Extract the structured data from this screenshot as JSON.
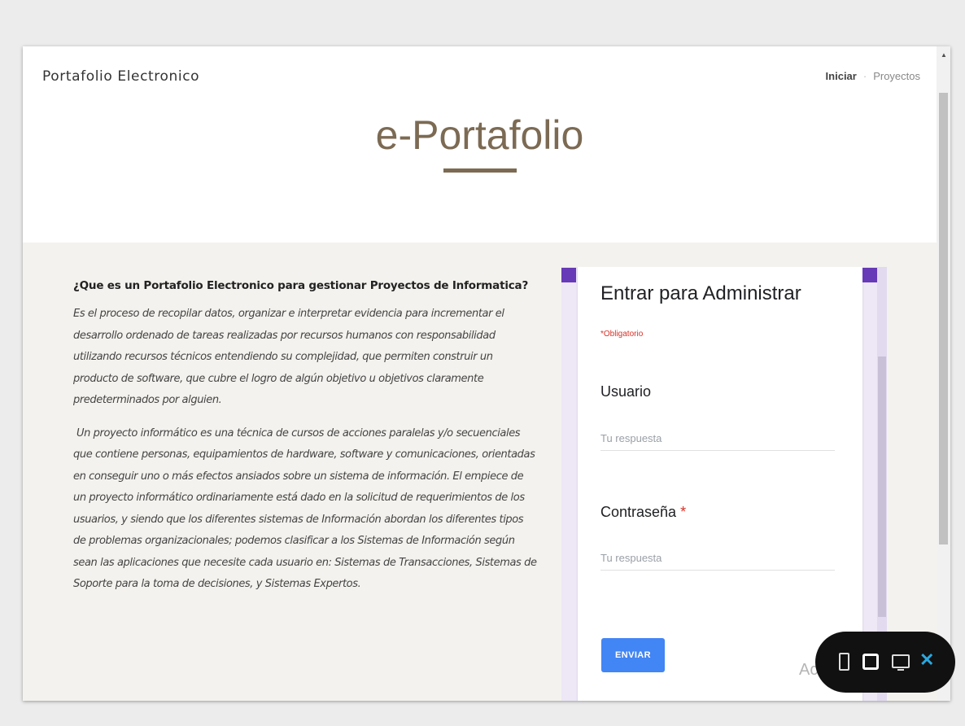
{
  "header": {
    "brand": "Portafolio Electronico",
    "nav": [
      "Iniciar",
      "Proyectos"
    ],
    "title": "e-Portafolio"
  },
  "content": {
    "question": "¿Que es un Portafolio Electronico para gestionar Proyectos de Informatica?",
    "paragraph1": "Es el proceso de recopilar datos, organizar e interpretar evidencia para incrementar el desarrollo ordenado de tareas realizadas por recursos humanos con responsabilidad utilizando recursos técnicos entendiendo su complejidad, que permiten construir un producto de software, que cubre el logro de algún objetivo u objetivos claramente predeterminados por alguien.",
    "paragraph2": "Un proyecto informático es una técnica de cursos de acciones paralelas y/o secuenciales que contiene personas, equipamientos de hardware, software y comunicaciones, orientadas en conseguir uno o más efectos ansiados sobre un sistema de información. El empiece de un proyecto informático ordinariamente está dado en la solicitud de requerimientos de los usuarios, y siendo que los diferentes sistemas de Información abordan los diferentes tipos de problemas organizacionales; podemos clasificar a los Sistemas de Información según sean las aplicaciones que necesite cada usuario en: Sistemas de Transacciones, Sistemas de Soporte para la toma de decisiones, y Sistemas Expertos."
  },
  "form": {
    "title": "Entrar para Administrar",
    "required_note": "*Obligatorio",
    "user_label": "Usuario",
    "user_placeholder": "Tu respuesta",
    "password_label": "Contraseña",
    "password_required_mark": "*",
    "password_placeholder": "Tu respuesta",
    "submit_label": "ENVIAR"
  },
  "overlay": {
    "watermark": "Activar Windows"
  },
  "colors": {
    "accent": "#7c6a53",
    "form_purple": "#673ab7",
    "submit_blue": "#4285f4",
    "required_red": "#d93025"
  }
}
